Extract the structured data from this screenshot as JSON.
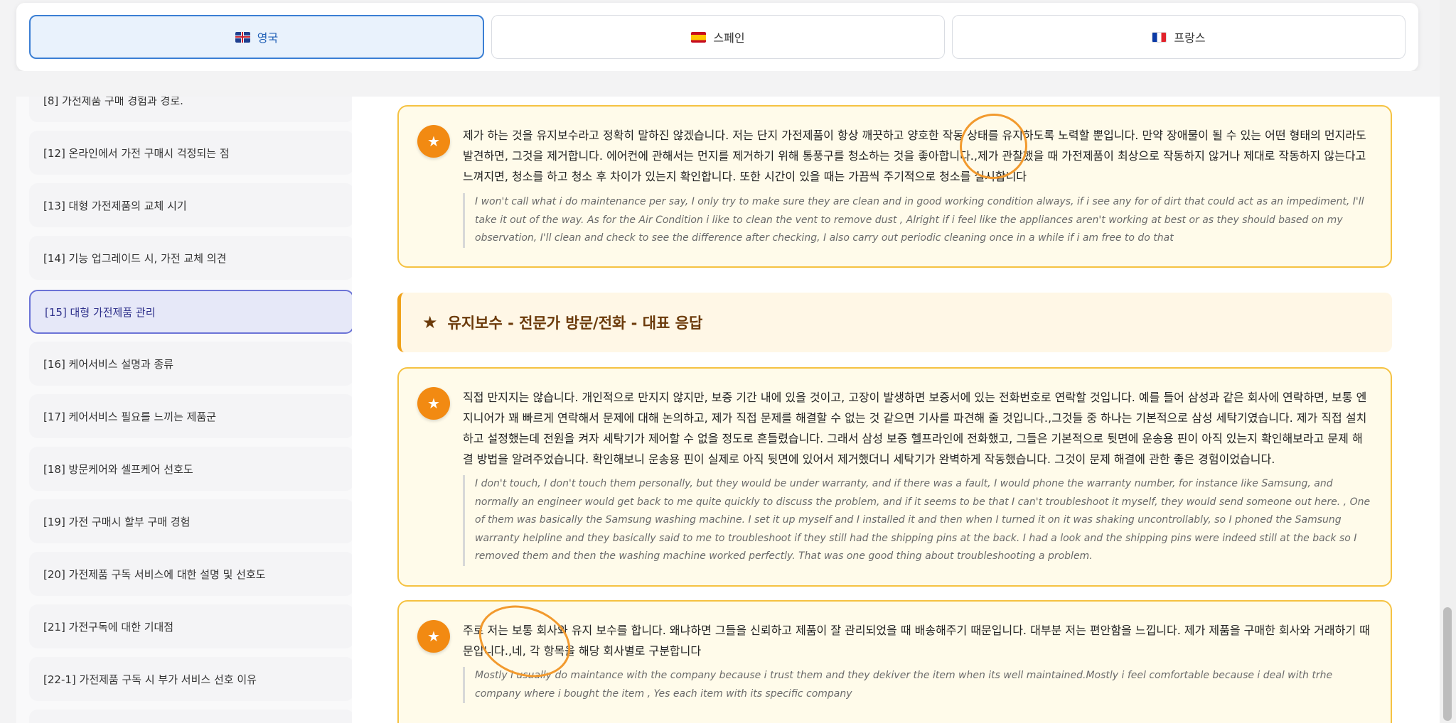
{
  "tabs": [
    {
      "label": "영국",
      "flag": "uk-flag-icon",
      "active": true
    },
    {
      "label": "스페인",
      "flag": "spain-flag-icon",
      "active": false
    },
    {
      "label": "프랑스",
      "flag": "france-flag-icon",
      "active": false
    }
  ],
  "sidebar": {
    "items": [
      {
        "label": "[8] 가전제품 구매 경험과 경로."
      },
      {
        "label": "[12] 온라인에서 가전 구매시 걱정되는 점"
      },
      {
        "label": "[13] 대형 가전제품의 교체 시기"
      },
      {
        "label": "[14] 기능 업그레이드 시, 가전 교체 의견"
      },
      {
        "label": "[15] 대형 가전제품 관리",
        "active": true
      },
      {
        "label": "[16] 케어서비스 설명과 종류"
      },
      {
        "label": "[17] 케어서비스 필요를 느끼는 제품군"
      },
      {
        "label": "[18] 방문케어와 셀프케어 선호도"
      },
      {
        "label": "[19] 가전 구매시 할부 구매 경험"
      },
      {
        "label": "[20] 가전제품 구독 서비스에 대한 설명 및 선호도"
      },
      {
        "label": "[21] 가전구독에 대한 기대점"
      },
      {
        "label": "[22-1] 가전제품 구독 시 부가 서비스 선호 이유"
      }
    ]
  },
  "main": {
    "section_title": "유지보수 - 전문가 방문/전화 - 대표 응답",
    "cards": [
      {
        "ko": "제가 하는 것을 유지보수라고 정확히 말하진 않겠습니다. 저는 단지 가전제품이 항상 깨끗하고 양호한 작동 상태를 유지하도록 노력할 뿐입니다. 만약 장애물이 될 수 있는 어떤 형태의 먼지라도 발견하면, 그것을 제거합니다. 에어컨에 관해서는 먼지를 제거하기 위해 통풍구를 청소하는 것을 좋아합니다.,제가 관찰했을 때 가전제품이 최상으로 작동하지 않거나 제대로 작동하지 않는다고 느껴지면, 청소를 하고 청소 후 차이가 있는지 확인합니다. 또한 시간이 있을 때는 가끔씩 주기적으로 청소를 실시합니다",
        "en": "I won't call what i do maintenance per say, I only try to make sure they are clean and in good working condition always, if i see any for of dirt that could act as an impediment, I'll take it out of the way. As for the Air Condition i like to clean the vent to remove dust , Alright if i feel like the appliances aren't working at best or as they should based on my observation, I'll clean and check to see the difference after checking, I also carry out periodic cleaning once in a while if i am free to do that"
      },
      {
        "ko": "직접 만지지는 않습니다. 개인적으로 만지지 않지만, 보증 기간 내에 있을 것이고, 고장이 발생하면 보증서에 있는 전화번호로 연락할 것입니다. 예를 들어 삼성과 같은 회사에 연락하면, 보통 엔지니어가 꽤 빠르게 연락해서 문제에 대해 논의하고, 제가 직접 문제를 해결할 수 없는 것 같으면 기사를 파견해 줄 것입니다.,그것들 중 하나는 기본적으로 삼성 세탁기였습니다. 제가 직접 설치하고 설정했는데 전원을 켜자 세탁기가 제어할 수 없을 정도로 흔들렸습니다. 그래서 삼성 보증 헬프라인에 전화했고, 그들은 기본적으로 뒷면에 운송용 핀이 아직 있는지 확인해보라고 문제 해결 방법을 알려주었습니다. 확인해보니 운송용 핀이 실제로 아직 뒷면에 있어서 제거했더니 세탁기가 완벽하게 작동했습니다. 그것이 문제 해결에 관한 좋은 경험이었습니다.",
        "en": "I don't touch, I don't touch them personally, but they would be under warranty, and if there was a fault, I would phone the warranty number, for instance like Samsung, and normally an engineer would get back to me quite quickly to discuss the problem, and if it seems to be that I can't troubleshoot it myself, they would send someone out here. , One of them was basically the Samsung washing machine. I set it up myself and I installed it and then when I turned it on it was shaking uncontrollably, so I phoned the Samsung warranty helpline and they basically said to me to troubleshoot if they still had the shipping pins at the back. I had a look and the shipping pins were indeed still at the back so I removed them and then the washing machine worked perfectly. That was one good thing about troubleshooting a problem."
      },
      {
        "ko": "주로 저는 보통 회사와 유지 보수를 합니다. 왜냐하면 그들을 신뢰하고 제품이 잘 관리되었을 때 배송해주기 때문입니다. 대부분 저는 편안함을 느낍니다. 제가 제품을 구매한 회사와 거래하기 때문입니다.,네, 각 항목을 해당 회사별로 구분합니다",
        "en": "Mostly i usually do maintance with the company because i trust them and they dekiver the item when its well maintained.Mostly i feel comfortable because i deal with trhe company where i bought the item , Yes each item with its specific company"
      }
    ]
  },
  "colors": {
    "accent_blue": "#3b7fd4",
    "card_border": "#f5c242",
    "card_bg": "#fffbea",
    "icon_orange": "#f28a12",
    "section_text": "#6b3a0a",
    "active_sidebar_border": "#6b73d6"
  }
}
